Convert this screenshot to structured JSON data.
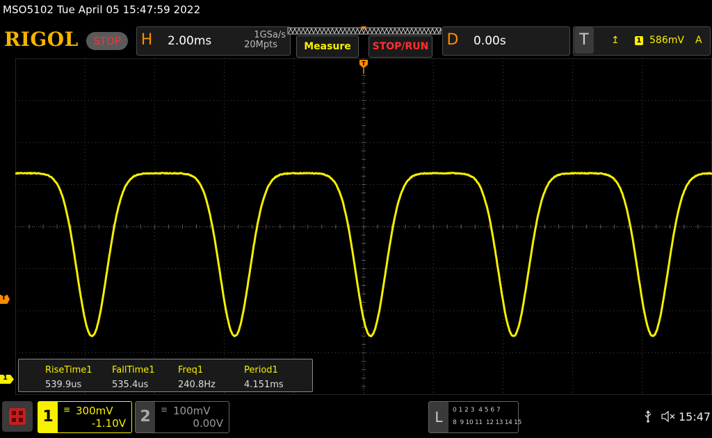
{
  "header": {
    "model_datetime": "MSO5102  Tue April 05 15:47:59 2022",
    "logo": "RIGOL",
    "run_state": "STOP"
  },
  "horizontal": {
    "letter": "H",
    "timebase": "2.00ms",
    "sample_rate": "1GSa/s",
    "memory_depth": "20Mpts"
  },
  "buttons": {
    "measure": "Measure",
    "stop_run": "STOP/RUN"
  },
  "delay": {
    "letter": "D",
    "value": "0.00s"
  },
  "trigger": {
    "letter": "T",
    "source_badge": "1",
    "level": "586mV",
    "mode": "A",
    "marker_letter": "T"
  },
  "measurements": [
    {
      "label": "RiseTime1",
      "value": "539.9us"
    },
    {
      "label": "FallTime1",
      "value": "535.4us"
    },
    {
      "label": "Freq1",
      "value": "240.8Hz"
    },
    {
      "label": "Period1",
      "value": "4.151ms"
    }
  ],
  "channel1": {
    "number": "1",
    "scale": "300mV",
    "offset": "-1.10V",
    "color": "#f7f000",
    "marker": "1"
  },
  "channel2": {
    "number": "2",
    "scale": "100mV",
    "offset": "0.00V",
    "color": "#9a9a9a"
  },
  "logic": {
    "letter": "L",
    "row1": "0 1 2 3  4 5 6 7",
    "row2": "8  9 10 11  12 13 14 15"
  },
  "status": {
    "time": "15:47",
    "usb_icon": "usb-icon",
    "speaker_icon": "speaker-muted-icon"
  },
  "colors": {
    "logo": "#f5b400",
    "trace": "#f7f000",
    "trigger": "#ff8c00",
    "stop": "#ff3030"
  },
  "waveform": {
    "timebase_s_per_div": 0.002,
    "period_ms": 4.151,
    "high_level_div": 1.27,
    "low_level_div": -2.6,
    "trough_ms": [
      -7.8,
      -3.7,
      0.2,
      4.3,
      8.3
    ]
  }
}
